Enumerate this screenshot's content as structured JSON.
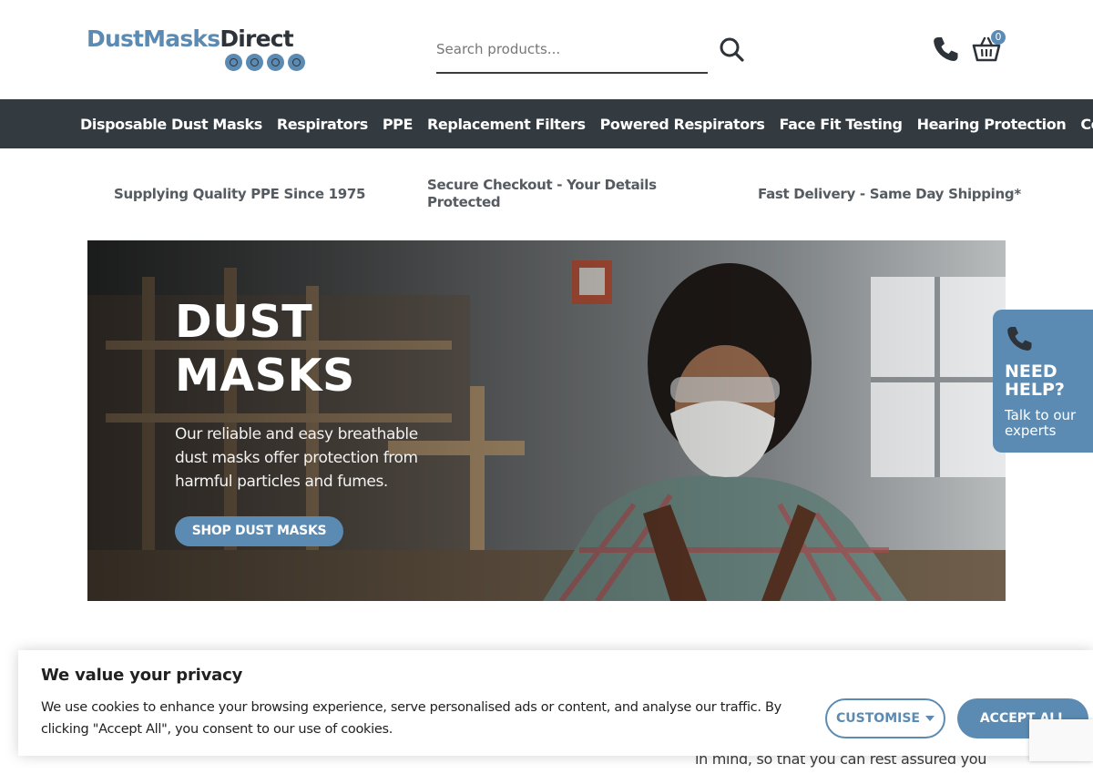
{
  "logo": {
    "part1": "DustMasks",
    "part2": "Direct"
  },
  "search": {
    "placeholder": "Search products..."
  },
  "cart": {
    "count": "0"
  },
  "nav": {
    "items": [
      "Disposable Dust Masks",
      "Respirators",
      "PPE",
      "Replacement Filters",
      "Powered Respirators",
      "Face Fit Testing",
      "Hearing Protection",
      "Contact"
    ]
  },
  "usp": {
    "item1": "Supplying Quality PPE Since 1975",
    "item2": "Secure Checkout - Your Details Protected",
    "item3": "Fast Delivery - Same Day Shipping*"
  },
  "hero": {
    "title": "DUST MASKS",
    "text": "Our reliable and easy breathable dust masks offer protection from harmful particles and fumes.",
    "button": "SHOP DUST MASKS"
  },
  "help": {
    "title": "NEED HELP?",
    "subtitle": "Talk to our experts"
  },
  "content": {
    "peek": "in mind, so that you can rest assured you"
  },
  "cookie": {
    "title": "We value your privacy",
    "text": "We use cookies to enhance your browsing experience, serve personalised ads or content, and analyse our traffic. By clicking \"Accept All\", you consent to our use of cookies.",
    "customise": "CUSTOMISE",
    "accept": "ACCEPT ALL"
  },
  "colors": {
    "brand_blue": "#5b8bb3",
    "nav_bg": "#333a40",
    "dark_text": "#2d3338"
  },
  "icons": [
    "search-icon",
    "phone-icon",
    "basket-icon",
    "caret-down-icon"
  ]
}
